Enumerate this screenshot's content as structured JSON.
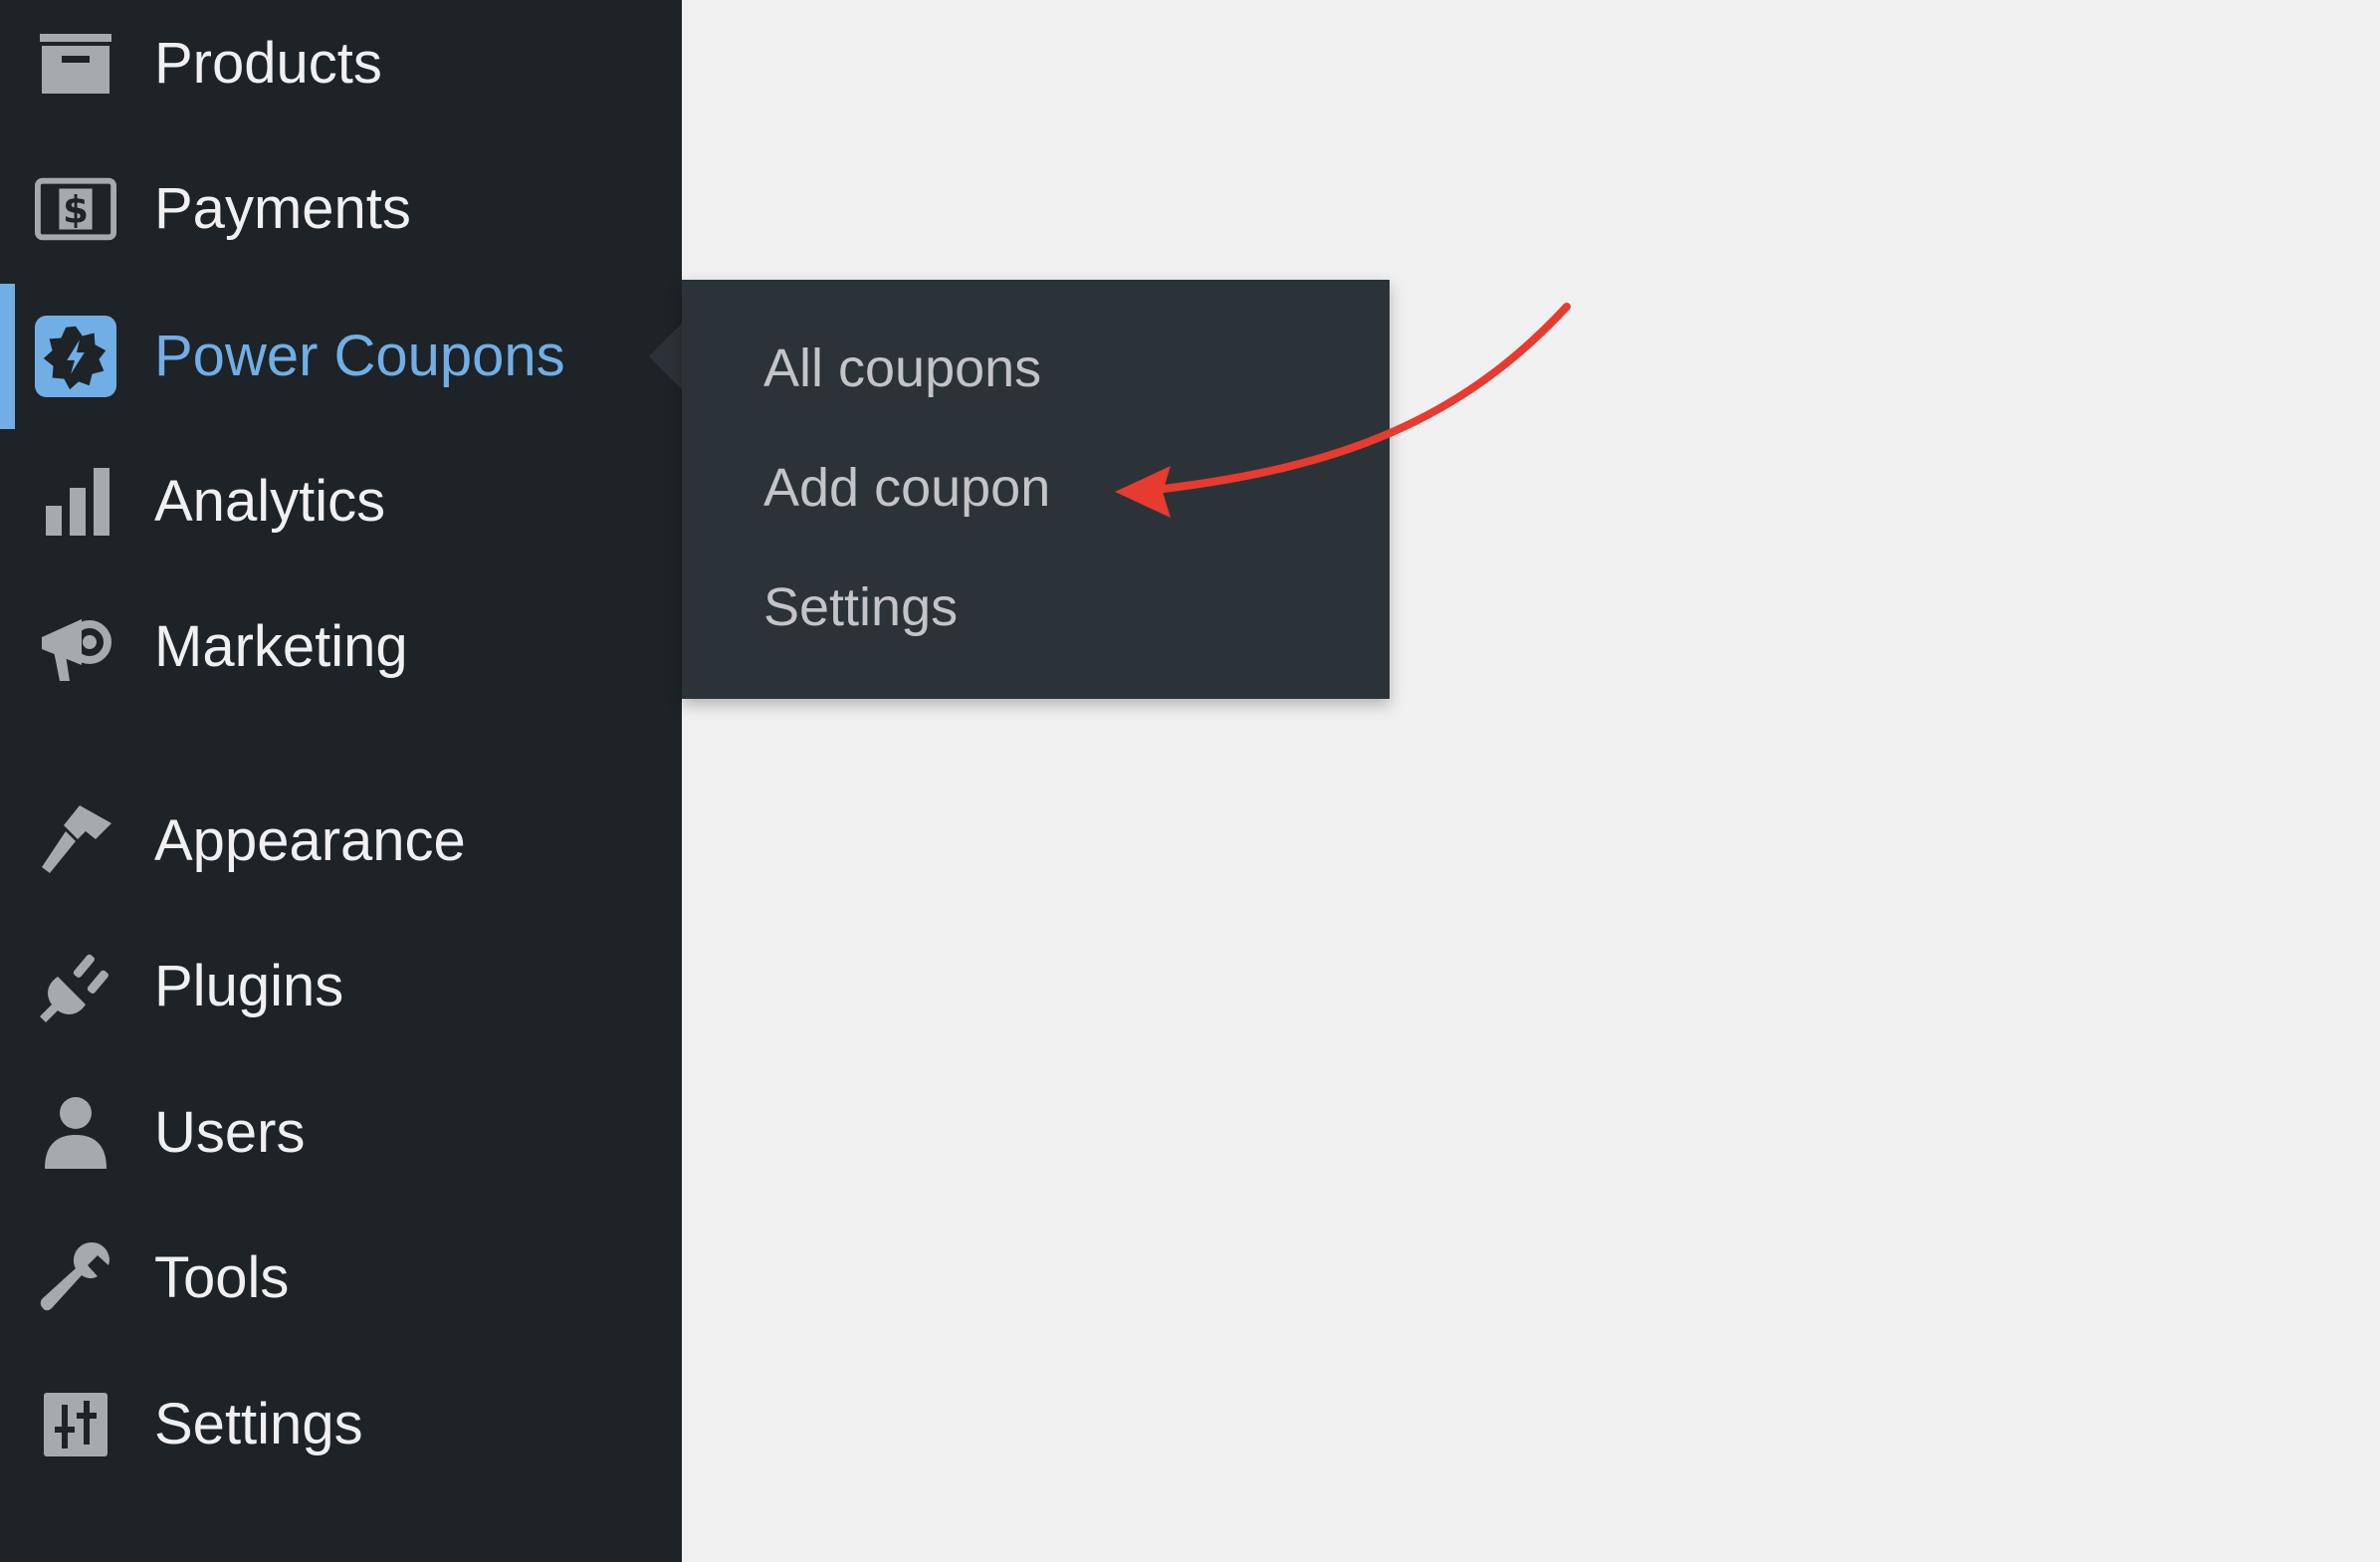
{
  "sidebar": {
    "items": [
      {
        "label": "Products",
        "icon": "archive-icon"
      },
      {
        "label": "Payments",
        "icon": "dollar-icon"
      },
      {
        "label": "Power Coupons",
        "icon": "coupon-badge-icon",
        "active": true
      },
      {
        "label": "Analytics",
        "icon": "bar-chart-icon"
      },
      {
        "label": "Marketing",
        "icon": "megaphone-icon"
      },
      {
        "label": "Appearance",
        "icon": "paintbrush-icon"
      },
      {
        "label": "Plugins",
        "icon": "plug-icon"
      },
      {
        "label": "Users",
        "icon": "user-icon"
      },
      {
        "label": "Tools",
        "icon": "wrench-icon"
      },
      {
        "label": "Settings",
        "icon": "sliders-icon"
      }
    ]
  },
  "flyout": {
    "items": [
      {
        "label": "All coupons"
      },
      {
        "label": "Add coupon"
      },
      {
        "label": "Settings"
      }
    ]
  },
  "colors": {
    "sidebar_bg": "#1d2327",
    "flyout_bg": "#2c3338",
    "content_bg": "#f0f0f1",
    "menu_text": "#f0f0f1",
    "submenu_text": "#c3c4c7",
    "icon": "#a7aaad",
    "active_accent": "#72aee6",
    "annotation_arrow": "#e63b2e"
  }
}
